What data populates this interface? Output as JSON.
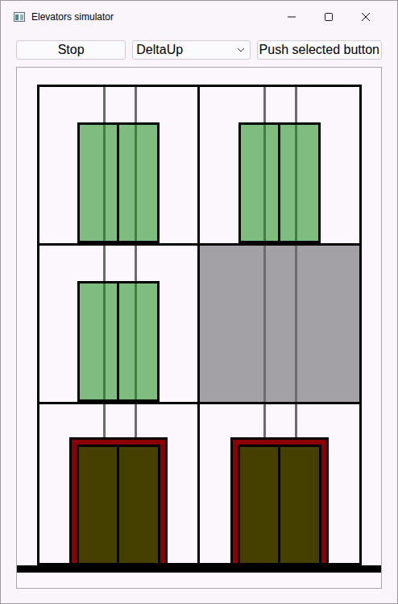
{
  "window": {
    "title": "Elevators simulator"
  },
  "toolbar": {
    "stop_button": "Stop",
    "dropdown": {
      "value": "DeltaUp"
    },
    "push_button": "Push selected button"
  },
  "shafts": [
    {
      "floors": [
        {
          "kind": "door",
          "highlighted": false
        },
        {
          "kind": "door",
          "highlighted": false
        },
        {
          "kind": "car",
          "highlighted": false
        }
      ]
    },
    {
      "floors": [
        {
          "kind": "door",
          "highlighted": false
        },
        {
          "kind": "empty",
          "highlighted": true
        },
        {
          "kind": "car",
          "highlighted": false
        }
      ]
    }
  ]
}
